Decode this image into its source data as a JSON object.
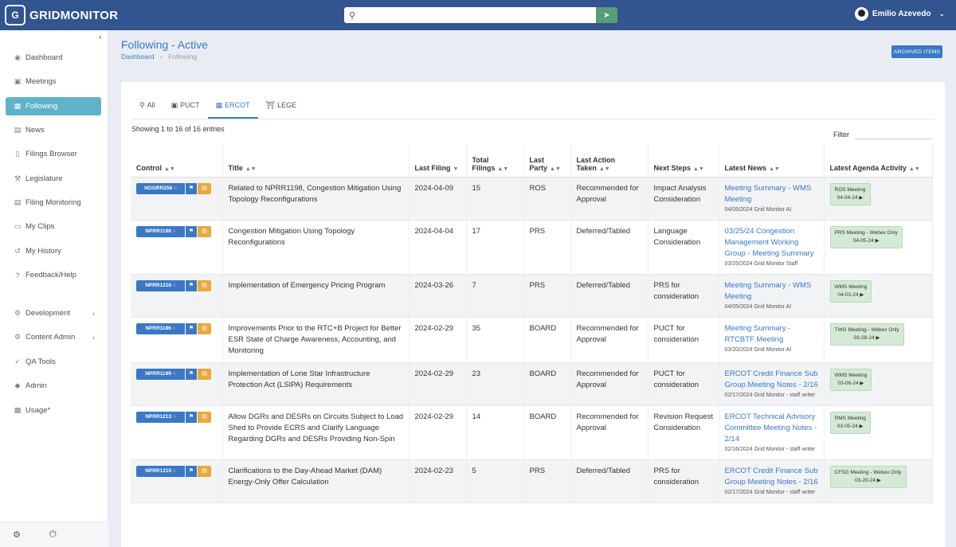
{
  "app": {
    "name": "GRIDMONITOR",
    "logo_mark": "G"
  },
  "search": {
    "placeholder": "",
    "value": ""
  },
  "user": {
    "name": "Emilio Azevedo"
  },
  "sidebar": {
    "items": [
      {
        "label": "Dashboard",
        "icon": "dashboard-icon"
      },
      {
        "label": "Meetings",
        "icon": "calendar-icon"
      },
      {
        "label": "Following",
        "icon": "bookmark-icon",
        "active": true
      },
      {
        "label": "News",
        "icon": "news-icon"
      },
      {
        "label": "Filings Browser",
        "icon": "file-icon"
      },
      {
        "label": "Legislature",
        "icon": "gavel-icon"
      },
      {
        "label": "Filing Monitoring",
        "icon": "monitor-icon"
      },
      {
        "label": "My Clips",
        "icon": "clips-icon"
      },
      {
        "label": "My History",
        "icon": "history-icon"
      },
      {
        "label": "Feedback/Help",
        "icon": "help-icon"
      },
      {
        "label": "Development",
        "icon": "dev-icon",
        "expandable": true
      },
      {
        "label": "Content Admin",
        "icon": "admin-gear-icon",
        "expandable": true
      },
      {
        "label": "QA Tools",
        "icon": "qa-icon"
      },
      {
        "label": "Admin",
        "icon": "shield-icon"
      },
      {
        "label": "Usage*",
        "icon": "chart-icon"
      }
    ]
  },
  "page": {
    "title": "Following - Active",
    "breadcrumb": {
      "home": "Dashboard",
      "current": "Following"
    },
    "archived_button": "ARCHIVED ITEMS"
  },
  "tabs": [
    {
      "label": "All",
      "icon": "search-icon"
    },
    {
      "label": "PUCT",
      "icon": "briefcase-icon"
    },
    {
      "label": "ERCOT",
      "icon": "building-icon",
      "active": true
    },
    {
      "label": "LEGE",
      "icon": "capitol-icon"
    }
  ],
  "table": {
    "entries_text": "Showing 1 to 16 of 16 entries",
    "filter_label": "Filter",
    "headers": [
      "Control",
      "Title",
      "Last Filing",
      "Total Filings",
      "Last Party",
      "Last Action Taken",
      "Next Steps",
      "Latest News",
      "Latest Agenda Activity"
    ],
    "rows": [
      {
        "control": "NOGRR258",
        "title": "Related to NPRR1198, Congestion Mitigation Using Topology Reconfigurations",
        "last_filing": "2024-04-09",
        "total": "15",
        "party": "ROS",
        "action": "Recommended for Approval",
        "next": "Impact Analysis Consideration",
        "news_title": "Meeting Summary - WMS Meeting",
        "news_meta": "04/05/2024 Grid Monitor AI",
        "agenda_title": "ROS Meeting",
        "agenda_date": "04-04-24 ▶"
      },
      {
        "control": "NPRR1198",
        "title": "Congestion Mitigation Using Topology Reconfigurations",
        "last_filing": "2024-04-04",
        "total": "17",
        "party": "PRS",
        "action": "Deferred/Tabled",
        "next": "Language Consideration",
        "news_title": "03/25/24 Congestion Management Working Group - Meeting Summary",
        "news_meta": "03/25/2024 Grid Monitor Staff",
        "agenda_title": "PRS Meeting - Webex Only",
        "agenda_date": "04-05-24 ▶"
      },
      {
        "control": "NPRR1216",
        "title": "Implementation of Emergency Pricing Program",
        "last_filing": "2024-03-26",
        "total": "7",
        "party": "PRS",
        "action": "Deferred/Tabled",
        "next": "PRS for consideration",
        "news_title": "Meeting Summary - WMS Meeting",
        "news_meta": "04/05/2024 Grid Monitor AI",
        "agenda_title": "WMS Meeting",
        "agenda_date": "04-03-24 ▶"
      },
      {
        "control": "NPRR1186",
        "title": "Improvements Prior to the RTC+B Project for Better ESR State of Charge Awareness, Accounting, and Monitoring",
        "last_filing": "2024-02-29",
        "total": "35",
        "party": "BOARD",
        "action": "Recommended for Approval",
        "next": "PUCT for consideration",
        "news_title": "Meeting Summary - RTCBTF Meeting",
        "news_meta": "03/20/2024 Grid Monitor AI",
        "agenda_title": "TWG Meeting - Webex Only",
        "agenda_date": "03-28-24 ▶"
      },
      {
        "control": "NPRR1199",
        "title": "Implementation of Lone Star Infrastructure Protection Act (LSIPA) Requirements",
        "last_filing": "2024-02-29",
        "total": "23",
        "party": "BOARD",
        "action": "Recommended for Approval",
        "next": "PUCT for consideration",
        "news_title": "ERCOT Credit Finance Sub Group Meeting Notes - 2/16",
        "news_meta": "02/17/2024 Grid Monitor - staff writer",
        "agenda_title": "WMS Meeting",
        "agenda_date": "03-06-24 ▶"
      },
      {
        "control": "NPRR1213",
        "title": "Allow DGRs and DESRs on Circuits Subject to Load Shed to Provide ECRS and Clarify Language Regarding DGRs and DESRs Providing Non-Spin",
        "last_filing": "2024-02-29",
        "total": "14",
        "party": "BOARD",
        "action": "Recommended for Approval",
        "next": "Revision Request Consideration",
        "news_title": "ERCOT Technical Advisory Committee Meeting Notes - 2/14",
        "news_meta": "02/16/2024 Grid Monitor - staff writer",
        "agenda_title": "RMS Meeting",
        "agenda_date": "03-05-24 ▶"
      },
      {
        "control": "NPRR1215",
        "title": "Clarifications to the Day-Ahead Market (DAM) Energy-Only Offer Calculation",
        "last_filing": "2024-02-23",
        "total": "5",
        "party": "PRS",
        "action": "Deferred/Tabled",
        "next": "PRS for consideration",
        "news_title": "ERCOT Credit Finance Sub Group Meeting Notes - 2/16",
        "news_meta": "02/17/2024 Grid Monitor - staff writer",
        "agenda_title": "CFSG Meeting - Webex Only",
        "agenda_date": "03-20-24 ▶"
      }
    ]
  }
}
